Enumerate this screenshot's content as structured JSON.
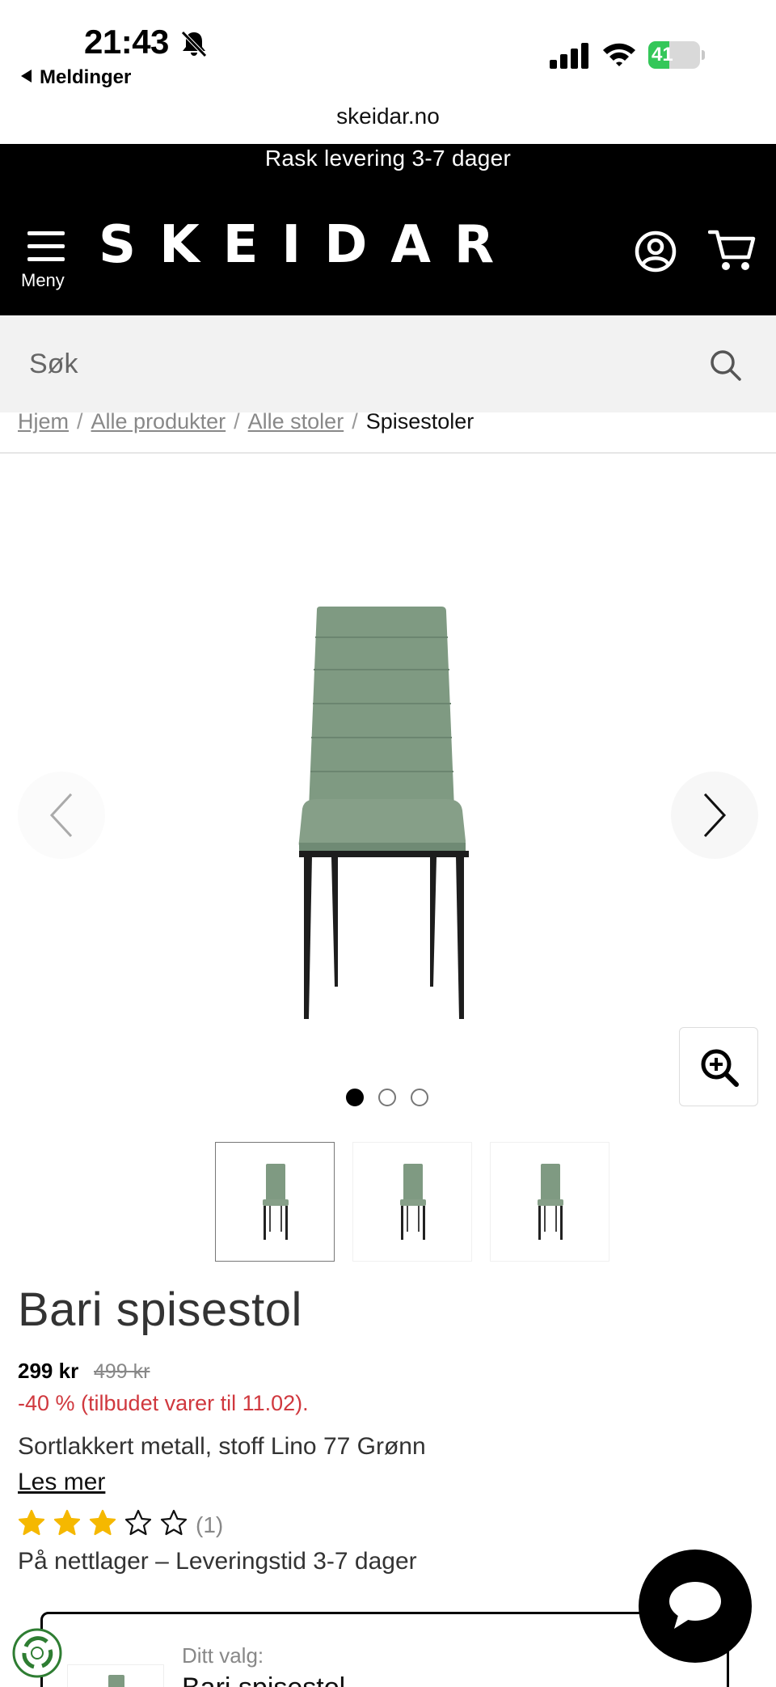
{
  "status_bar": {
    "time": "21:43",
    "back_app": "Meldinger",
    "battery_level": "41",
    "battery_fraction": 0.41,
    "icons": [
      "bell-slash-icon",
      "cellular-signal-icon",
      "wifi-icon",
      "battery-charging-icon"
    ]
  },
  "browser": {
    "url": "skeidar.no"
  },
  "promo": {
    "text": "Rask levering 3-7 dager"
  },
  "header": {
    "menu_label": "Meny",
    "logo": "SKEIDAR",
    "icons": [
      "menu-icon",
      "account-icon",
      "cart-icon"
    ]
  },
  "search": {
    "placeholder": "Søk"
  },
  "breadcrumb": {
    "items": [
      "Hjem",
      "Alle produkter",
      "Alle stoler"
    ],
    "current": "Spisestoler",
    "separator": "/"
  },
  "gallery": {
    "image_count": 3,
    "active_index": 0,
    "icons": [
      "chevron-left-icon",
      "chevron-right-icon",
      "zoom-in-icon"
    ]
  },
  "product": {
    "title": "Bari spisestol",
    "price": "299 kr",
    "old_price": "499 kr",
    "discount_text": "-40 % (tilbudet varer til 11.02).",
    "description": "Sortlakkert metall, stoff Lino 77 Grønn",
    "read_more": "Les mer",
    "rating": 3,
    "rating_max": 5,
    "rating_count": "(1)",
    "stock_text": "På nettlager – Leveringstid 3-7 dager"
  },
  "selection": {
    "label": "Ditt valg:",
    "value": "Bari spisestol"
  },
  "colors": {
    "header_bg": "#000000",
    "search_bg": "#f2f2f2",
    "discount": "#d0383e",
    "star": "#f5b800",
    "chair_fabric": "#7f9a82",
    "battery": "#34c759"
  }
}
